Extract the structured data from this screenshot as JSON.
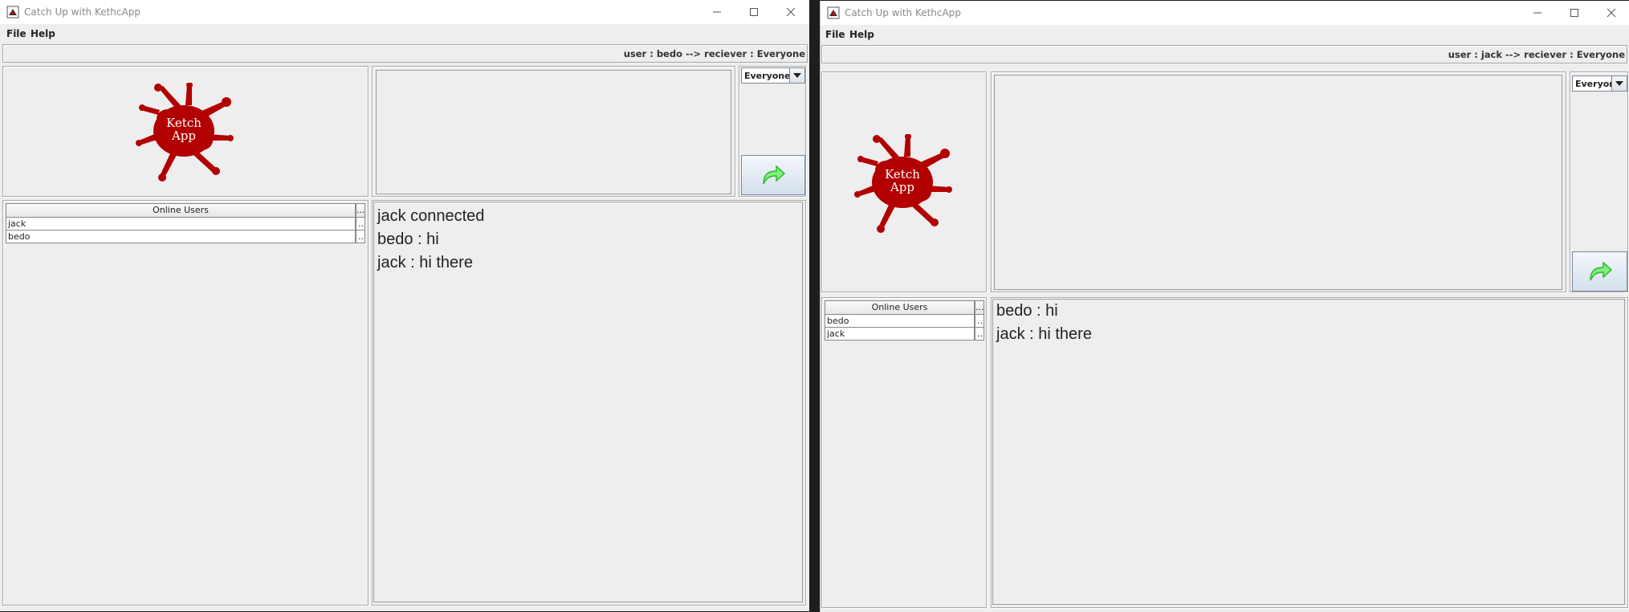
{
  "colors": {
    "logo_red": "#b20000",
    "send_arrow": "#3bc93b",
    "title_text": "#8a8a8a"
  },
  "windows": [
    {
      "title": "Catch Up with KethcApp",
      "menu": [
        "File",
        "Help"
      ],
      "status": "user : bedo --> reciever : Everyone",
      "logo_text": [
        "Ketch",
        "App"
      ],
      "receiver_select": "Everyone",
      "send_icon": "curved-arrow-icon",
      "online_users": {
        "header": "Online Users",
        "header_extra": "...",
        "rows": [
          {
            "name": "jack",
            "extra": "..."
          },
          {
            "name": "bedo",
            "extra": "..."
          }
        ]
      },
      "messages": [
        "jack connected",
        "bedo : hi",
        "jack : hi there"
      ]
    },
    {
      "title": "Catch Up with KethcApp",
      "menu": [
        "File",
        "Help"
      ],
      "status": "user : jack --> reciever : Everyone",
      "logo_text": [
        "Ketch",
        "App"
      ],
      "receiver_select": "Everyone",
      "send_icon": "curved-arrow-icon",
      "online_users": {
        "header": "Online Users",
        "header_extra": "...",
        "rows": [
          {
            "name": "bedo",
            "extra": "..."
          },
          {
            "name": "jack",
            "extra": "..."
          }
        ]
      },
      "messages": [
        "bedo : hi",
        "jack : hi there"
      ]
    }
  ]
}
